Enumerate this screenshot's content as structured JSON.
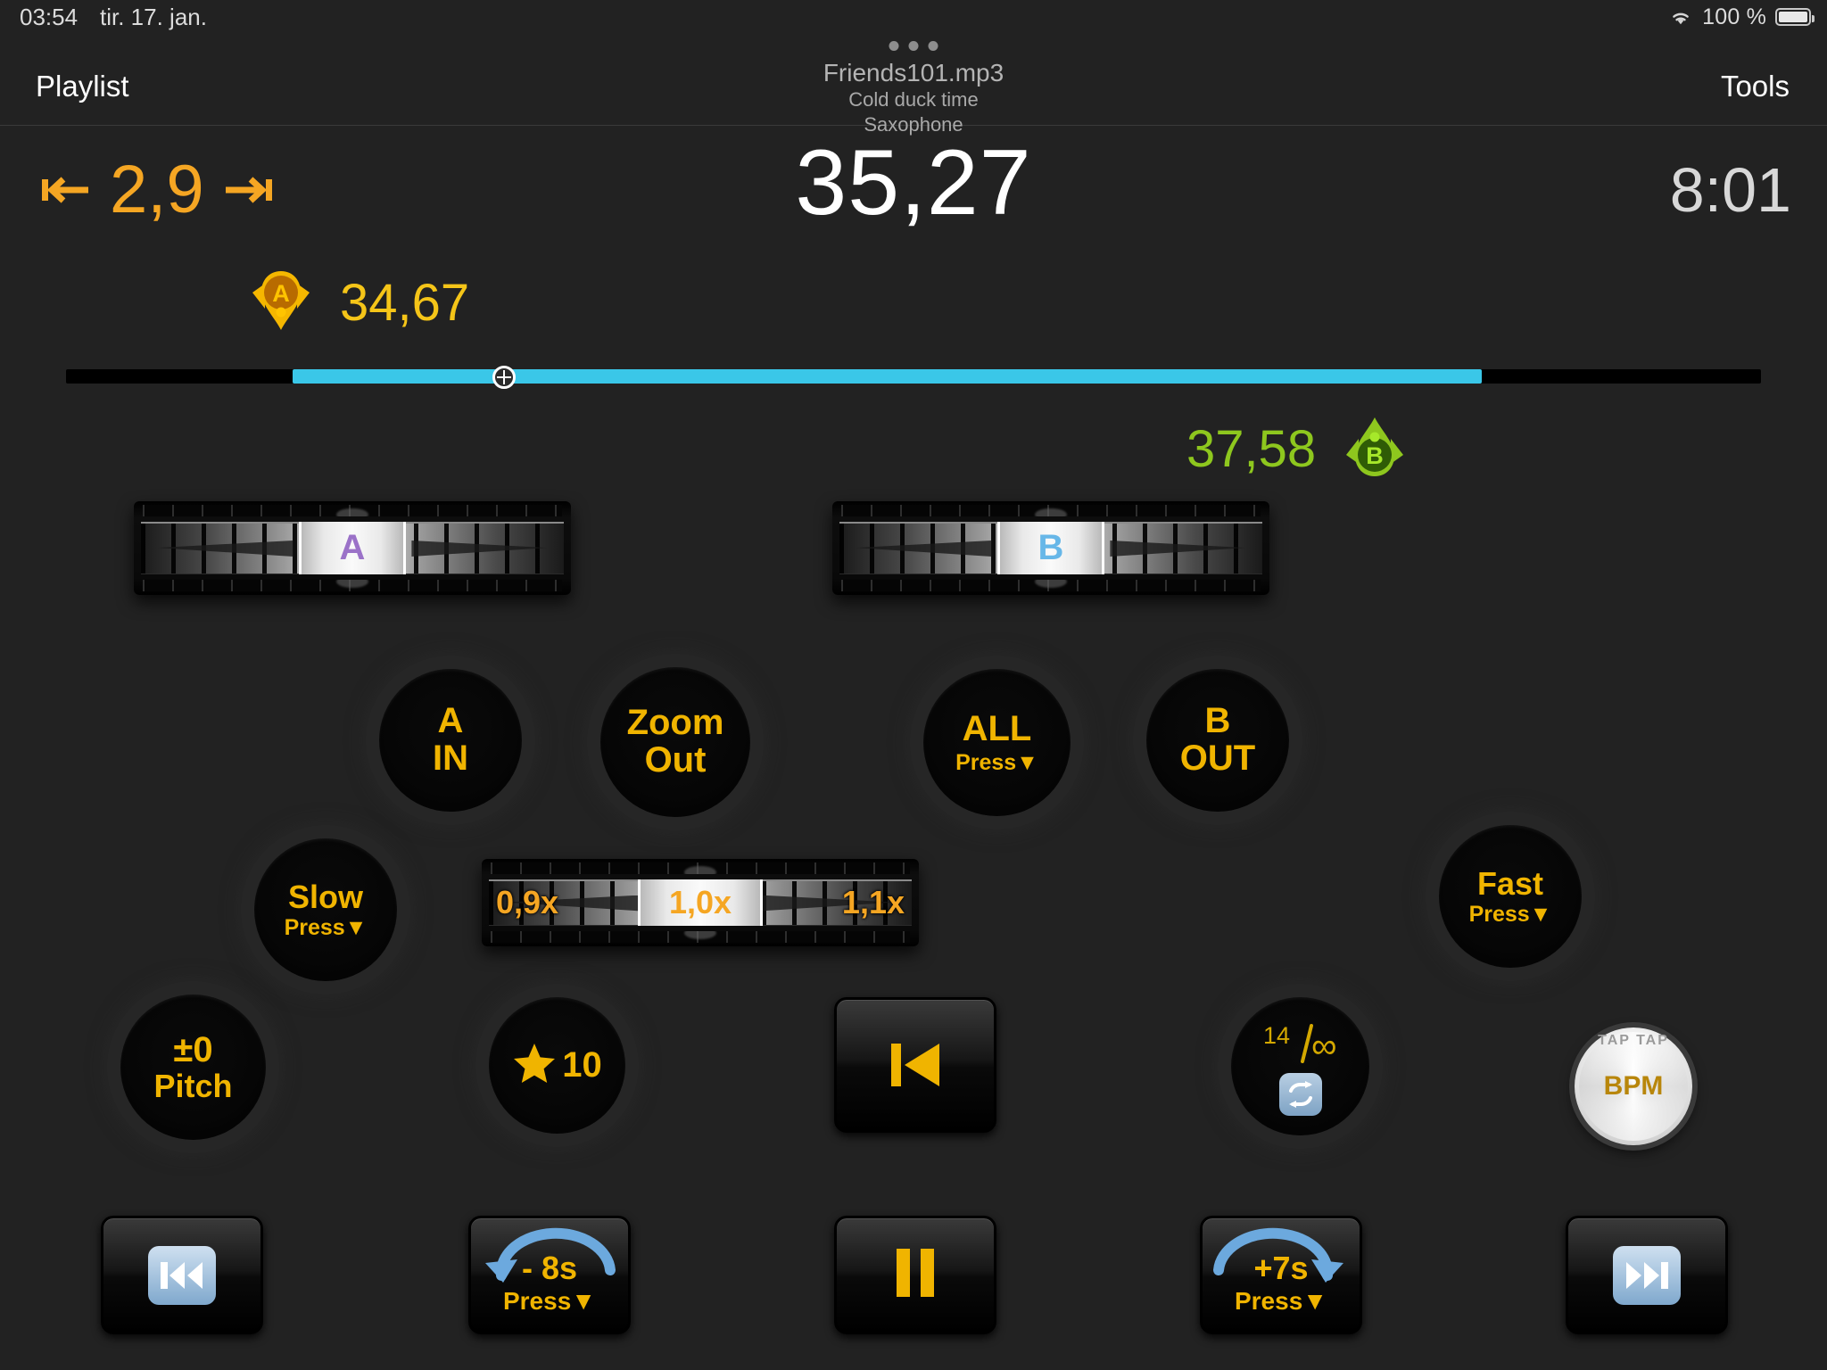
{
  "statusbar": {
    "time": "03:54",
    "date": "tir. 17. jan.",
    "battery_percent": "100 %",
    "wifi_icon": "wifi-icon",
    "battery_icon": "battery-full-icon"
  },
  "navbar": {
    "left_button": "Playlist",
    "right_button": "Tools",
    "file_name": "Friends101.mp3",
    "track_title": "Cold duck time",
    "instrument": "Saxophone",
    "more_dots": "more-dots-icon"
  },
  "transport": {
    "loop_duration": "2,9",
    "current_position": "35,27",
    "total_duration": "8:01",
    "marker_a_value": "34,67",
    "marker_b_value": "37,58",
    "marker_a_letter": "A",
    "marker_b_letter": "B"
  },
  "colors": {
    "amber": "#f0b400",
    "orange": "#f5a623",
    "yellow": "#f5c518",
    "green": "#8ec71e",
    "cyan": "#3ac7e8",
    "blue": "#6ca9de",
    "purple": "#9b72c8",
    "lightblue": "#67b7e8",
    "background": "#222222"
  },
  "progress": {
    "fill_percent": 70,
    "handle_percent": 25
  },
  "wheels": {
    "a_label": "A",
    "b_label": "B",
    "tempo_left": "0,9x",
    "tempo_center": "1,0x",
    "tempo_right": "1,1x"
  },
  "round_buttons": [
    {
      "name": "a-in",
      "line1": "A",
      "line2": "IN",
      "press": ""
    },
    {
      "name": "zoom-out",
      "line1": "Zoom",
      "line2": "Out",
      "press": ""
    },
    {
      "name": "all",
      "line1": "ALL",
      "line2": "",
      "press": "Press▼"
    },
    {
      "name": "b-out",
      "line1": "B",
      "line2": "OUT",
      "press": ""
    },
    {
      "name": "slow",
      "line1": "Slow",
      "line2": "",
      "press": "Press▼"
    },
    {
      "name": "fast",
      "line1": "Fast",
      "line2": "",
      "press": "Press▼"
    },
    {
      "name": "pitch",
      "line1": "±0",
      "line2": "Pitch",
      "press": ""
    }
  ],
  "star_button": {
    "label": "10",
    "icon": "star-icon"
  },
  "loop_button": {
    "count": "14",
    "infinity": "∞",
    "icon": "repeat-icon"
  },
  "bpm_button": {
    "label": "BPM",
    "tap_label": "TAP TAP"
  },
  "rewind_button": {
    "icon": "skip-to-start-icon"
  },
  "bottom_buttons": {
    "prev_track": {
      "icon": "previous-track-icon"
    },
    "back": {
      "label": "- 8s",
      "press": "Press▼",
      "icon": "rotate-back-icon"
    },
    "pause": {
      "icon": "pause-icon"
    },
    "forward": {
      "label": "+7s",
      "press": "Press▼",
      "icon": "rotate-forward-icon"
    },
    "next_track": {
      "icon": "next-track-icon"
    }
  }
}
